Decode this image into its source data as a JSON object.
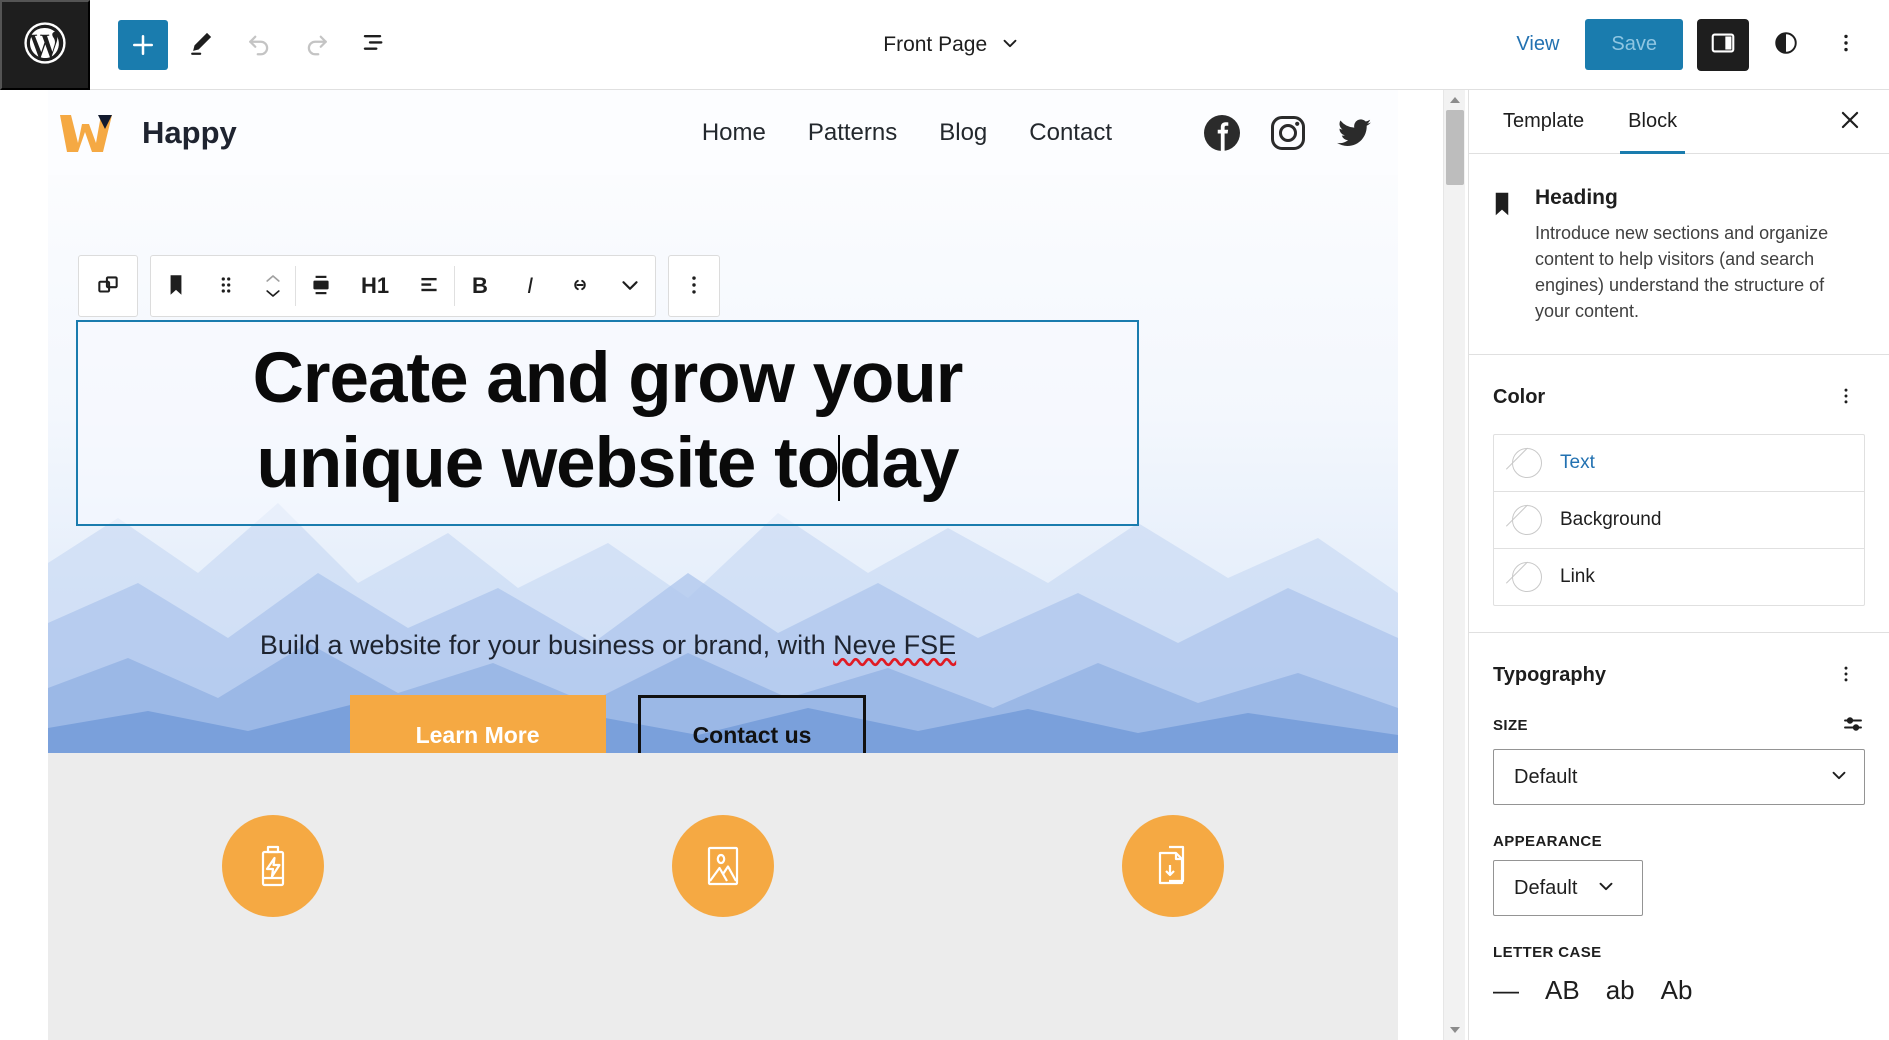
{
  "topbar": {
    "wp_logo": "wordpress-logo",
    "tools": [
      {
        "name": "block-inserter",
        "icon": "plus-icon",
        "label": "Toggle block inserter"
      },
      {
        "name": "edit-mode",
        "icon": "pencil-icon",
        "label": "Edit"
      },
      {
        "name": "undo",
        "icon": "undo-arrow-icon",
        "label": "Undo"
      },
      {
        "name": "redo",
        "icon": "redo-arrow-icon",
        "label": "Redo"
      },
      {
        "name": "list-view",
        "icon": "list-view-icon",
        "label": "Document Overview"
      }
    ],
    "document_title": "Front Page",
    "view_label": "View",
    "save_label": "Save",
    "accent_blue": "#1a7cae",
    "save_text_color": "#8fc6e2"
  },
  "block_toolbar": {
    "select_parent": "select-parent-block",
    "items": [
      {
        "name": "block-type-heading",
        "icon": "heading-bookmark-icon"
      },
      {
        "name": "drag-handle",
        "icon": "drag-dots-icon"
      },
      {
        "name": "move-up-down",
        "icon": "chevron-up-down-icon"
      },
      {
        "name": "change-alignment",
        "icon": "align-icon"
      },
      {
        "name": "heading-level",
        "label": "H1"
      },
      {
        "name": "text-align",
        "icon": "text-align-icon"
      },
      {
        "name": "bold",
        "label": "B"
      },
      {
        "name": "italic",
        "label": "I"
      },
      {
        "name": "link",
        "icon": "link-icon"
      },
      {
        "name": "more-rich-text",
        "icon": "chevron-down-icon"
      },
      {
        "name": "block-options",
        "icon": "three-dots-vertical-icon"
      }
    ]
  },
  "site": {
    "title": "Happy",
    "logo_colors": {
      "primary": "#f5a943",
      "accent": "#121a2e"
    },
    "nav": [
      {
        "label": "Home"
      },
      {
        "label": "Patterns"
      },
      {
        "label": "Blog"
      },
      {
        "label": "Contact"
      }
    ],
    "social": [
      {
        "name": "facebook-icon"
      },
      {
        "name": "instagram-icon"
      },
      {
        "name": "twitter-icon"
      }
    ]
  },
  "hero": {
    "heading_before_caret": "Create and grow your unique website to",
    "heading_after_caret": "day",
    "heading_full": "Create and grow your unique website today",
    "heading_line1": "Create and grow your",
    "heading_line2_before": "unique website to",
    "heading_line2_after": "day",
    "subtitle_plain": "Build a website for your business or brand, with ",
    "subtitle_misspelled": "Neve FSE",
    "buttons": [
      {
        "name": "learn-more-button",
        "label": "Learn More",
        "style": "filled",
        "color": "#f5a943"
      },
      {
        "name": "contact-us-button",
        "label": "Contact us",
        "style": "outline"
      }
    ]
  },
  "features": [
    {
      "name": "feature-fast",
      "icon": "battery-lightning-icon"
    },
    {
      "name": "feature-image",
      "icon": "image-picture-icon"
    },
    {
      "name": "feature-download",
      "icon": "document-download-icon"
    }
  ],
  "sidebar": {
    "tabs": [
      {
        "label": "Template",
        "active": false
      },
      {
        "label": "Block",
        "active": true
      }
    ],
    "close_label": "Close Settings",
    "block": {
      "icon": "heading-bookmark-icon",
      "title": "Heading",
      "description": "Introduce new sections and organize content to help visitors (and search engines) understand the structure of your content."
    },
    "color_panel": {
      "title": "Color",
      "rows": [
        {
          "label": "Text",
          "value": "",
          "highlighted": true
        },
        {
          "label": "Background",
          "value": "",
          "highlighted": false
        },
        {
          "label": "Link",
          "value": "",
          "highlighted": false
        }
      ]
    },
    "typography_panel": {
      "title": "Typography",
      "size_label": "Size",
      "size_value": "Default",
      "appearance_label": "Appearance",
      "appearance_value": "Default",
      "letter_case_label": "Letter case",
      "letter_case_options": [
        "—",
        "AB",
        "ab",
        "Ab"
      ]
    }
  }
}
